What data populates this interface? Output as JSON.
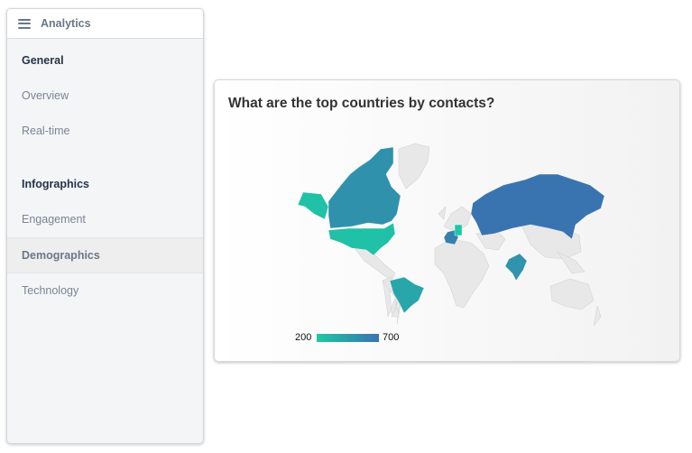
{
  "sidebar": {
    "title": "Analytics",
    "menu_icon": "hamburger-menu-icon",
    "sections": [
      {
        "label": "General",
        "items": [
          {
            "label": "Overview",
            "active": false
          },
          {
            "label": "Real-time",
            "active": false
          }
        ]
      },
      {
        "label": "Infographics",
        "items": [
          {
            "label": "Engagement",
            "active": false
          },
          {
            "label": "Demographics",
            "active": true
          },
          {
            "label": "Technology",
            "active": false
          }
        ]
      }
    ]
  },
  "card": {
    "title": "What are the top countries by contacts?"
  },
  "chart_data": {
    "type": "choropleth",
    "title": "What are the top countries by contacts?",
    "metric": "contacts",
    "color_scale": {
      "min": 200,
      "max": 700,
      "min_color": "#1ec8a5",
      "max_color": "#3a72b0"
    },
    "legend": {
      "min_label": "200",
      "max_label": "700",
      "placement": "bottom-left"
    },
    "regions": [
      {
        "name": "United States",
        "value": 240
      },
      {
        "name": "Canada",
        "value": 520
      },
      {
        "name": "Brazil",
        "value": 400
      },
      {
        "name": "Russia",
        "value": 690
      },
      {
        "name": "India",
        "value": 500
      },
      {
        "name": "France",
        "value": 620
      },
      {
        "name": "Germany",
        "value": 210
      }
    ],
    "no_data_color": "#e6e6e6"
  }
}
